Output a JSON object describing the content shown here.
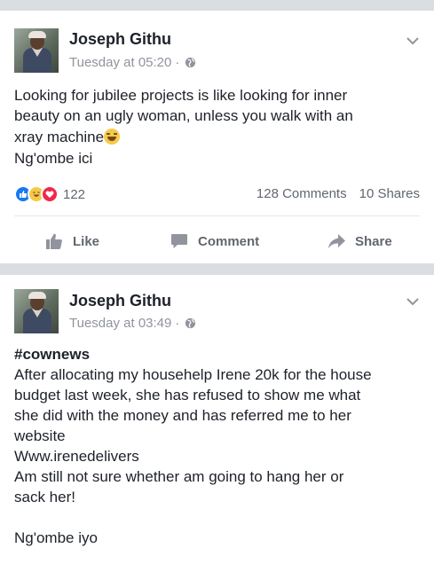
{
  "posts": [
    {
      "author": "Joseph Githu",
      "time": "Tuesday at 05:20",
      "dot": "·",
      "lines": [
        "Looking for jubilee projects is like looking for inner",
        "beauty on an ugly woman, unless you walk with an",
        "xray machine",
        "Ng'ombe ici"
      ],
      "reaction_count": "122",
      "comments": "128 Comments",
      "shares": "10 Shares",
      "actions": {
        "like": "Like",
        "comment": "Comment",
        "share": "Share"
      }
    },
    {
      "author": "Joseph Githu",
      "time": "Tuesday at 03:49",
      "dot": "·",
      "hashtag": "#cownews",
      "lines": [
        "After allocating my househelp Irene 20k for the house",
        "budget last week, she has refused to show me what",
        "she did with the money and has referred me to her",
        "website",
        "Www.irenedelivers",
        "Am still not sure whether am going to hang her or",
        "sack her!",
        "",
        "Ng'ombe iyo"
      ]
    }
  ],
  "colors": {
    "like_blue": "#1877f2",
    "haha_yellow": "#f7c94b",
    "love_red": "#f0284a",
    "muted_text": "#90949c",
    "action_text": "#606770",
    "separator": "#dadde1"
  }
}
